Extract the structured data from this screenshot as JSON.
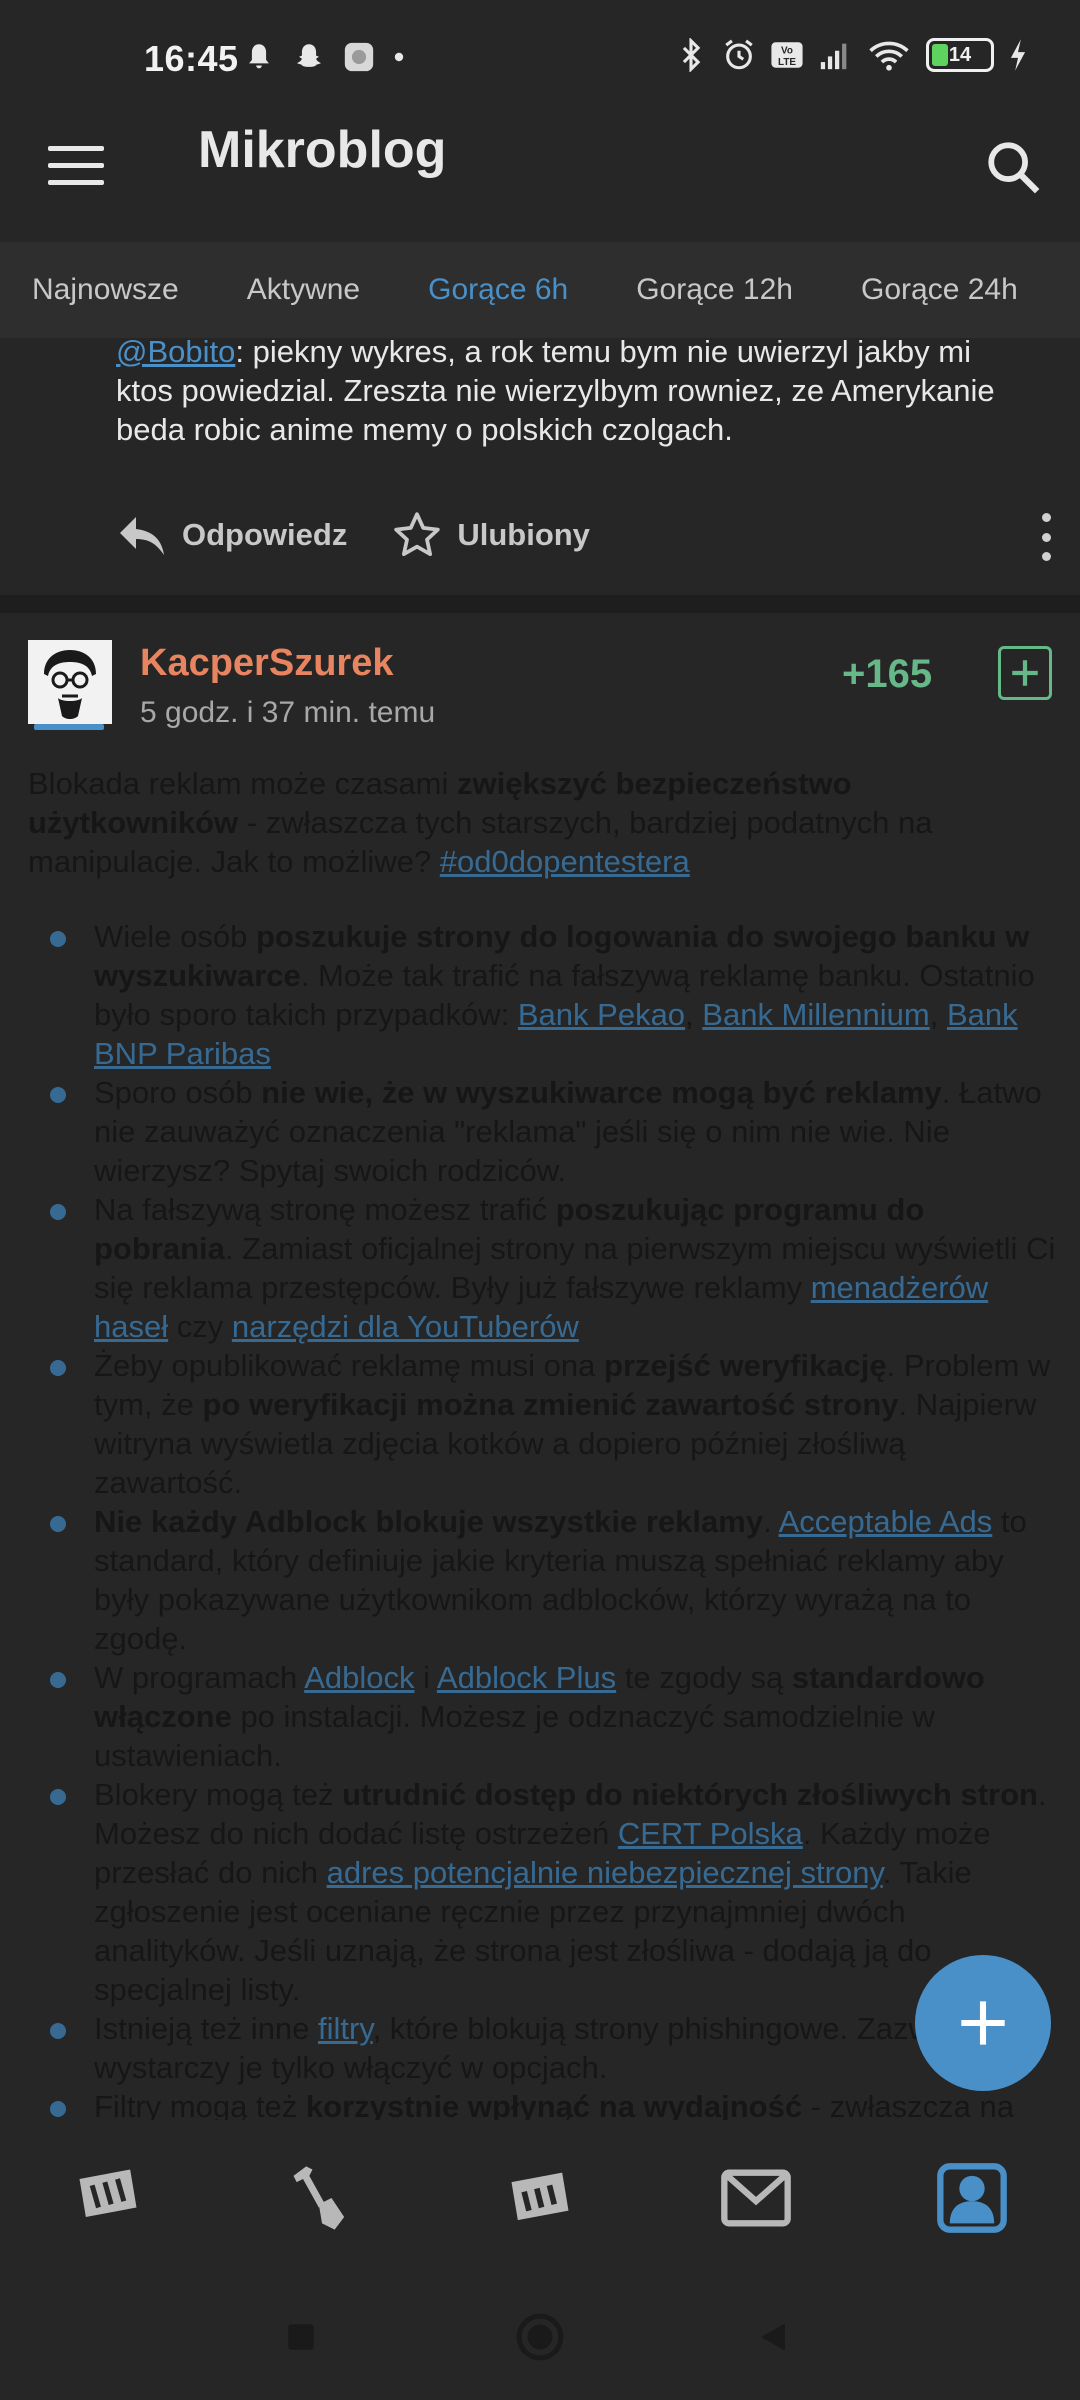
{
  "status_bar": {
    "time": "16:45",
    "battery": "14",
    "icons_left": [
      "bell-icon",
      "snapchat-icon",
      "app-icon",
      "dot-icon"
    ],
    "icons_right": [
      "bluetooth-icon",
      "alarm-icon",
      "volte-icon",
      "signal-icon",
      "wifi-icon",
      "battery-icon",
      "charging-icon"
    ]
  },
  "app_bar": {
    "title": "Mikroblog"
  },
  "tabs": [
    {
      "label": "Najnowsze",
      "active": false
    },
    {
      "label": "Aktywne",
      "active": false
    },
    {
      "label": "Gorące 6h",
      "active": true
    },
    {
      "label": "Gorące 12h",
      "active": false
    },
    {
      "label": "Gorące 24h",
      "active": false
    }
  ],
  "previous_comment": {
    "mention": "@Bobito",
    "text": ": piekny wykres, a rok temu bym nie uwierzyl jakby mi ktos powiedzial. Zreszta nie wierzylbym rowniez, ze Amerykanie beda robic anime memy o polskich czolgach.",
    "reply_label": "Odpowiedz",
    "favorite_label": "Ulubiony"
  },
  "post": {
    "author": "KacperSzurek",
    "time": "5 godz. i 37 min. temu",
    "votes": "+165",
    "intro": {
      "p1": "Blokada reklam może czasami ",
      "b1": "zwiększyć bezpieczeństwo użytkowników",
      "p2": " - zwłaszcza tych starszych, bardziej podatnych na manipulacje. Jak to możliwe? ",
      "tag": "#od0dopentestera"
    },
    "bullets": {
      "b1": {
        "t1": "Wiele osób ",
        "s1": "poszukuje strony do logowania do swojego banku w wyszukiwarce",
        "t2": ". Może tak trafić na fałszywą reklamę banku. Ostatnio było sporo takich przypadków: ",
        "l1": "Bank Pekao",
        "t3": ", ",
        "l2": "Bank Millennium",
        "t4": ", ",
        "l3": "Bank BNP Paribas"
      },
      "b2": {
        "t1": "Sporo osób ",
        "s1": "nie wie, że w wyszukiwarce mogą być reklamy",
        "t2": ". Łatwo nie zauważyć oznaczenia \"reklama\" jeśli się o nim nie wie. Nie wierzysz? Spytaj swoich rodziców."
      },
      "b3": {
        "t1": "Na fałszywą stronę możesz trafić ",
        "s1": "poszukując programu do pobrania",
        "t2": ". Zamiast oficjalnej strony na pierwszym miejscu wyświetli Ci się reklama przestępców. Były już fałszywe reklamy ",
        "l1": "menadżerów haseł",
        "t3": " czy ",
        "l2": "narzędzi dla YouTuberów"
      },
      "b4": {
        "t1": "Żeby opublikować reklamę musi ona ",
        "s1": "przejść weryfikację",
        "t2": ". Problem w tym, że ",
        "s2": "po weryfikacji można zmienić zawartość strony",
        "t3": ". Najpierw witryna wyświetla zdjęcia kotków a dopiero później złośliwą zawartość."
      },
      "b5": {
        "s1": "Nie każdy Adblock blokuje wszystkie reklamy",
        "t1": ". ",
        "l1": "Acceptable Ads",
        "t2": " to standard, który definiuje jakie kryteria muszą spełniać reklamy aby były pokazywane użytkownikom adblocków, którzy wyrażą na to zgodę."
      },
      "b6": {
        "t1": "W programach ",
        "l1": "Adblock",
        "t2": " i ",
        "l2": "Adblock Plus",
        "t3": " te zgody są ",
        "s1": "standardowo włączone",
        "t4": " po instalacji. Możesz je odznaczyć samodzielnie w ustawieniach."
      },
      "b7": {
        "t1": "Blokery mogą też ",
        "s1": "utrudnić dostęp do niektórych złośliwych stron",
        "t2": ". Możesz do nich dodać listę ostrzeżeń ",
        "l1": "CERT Polska",
        "t3": ". Każdy może przesłać do nich ",
        "l2": "adres potencjalnie niebezpiecznej strony",
        "t4": ". Takie zgłoszenie jest oceniane ręcznie przez przynajmniej dwóch analityków. Jeśli uznają, że strona jest złośliwa - dodają ją do specjalnej listy."
      },
      "b8": {
        "t1": "Istnieją też inne ",
        "l1": "filtry",
        "t2": ", które blokują strony phishingowe. Zazwyczaj wystarczy je tylko włączyć w opcjach."
      },
      "b9": {
        "t1": "Filtry mogą też ",
        "s1": "korzystnie wpłynąć na wydajność",
        "t2": " - zwłaszcza na"
      }
    }
  },
  "bottom_nav": [
    "wykop-home-icon",
    "dig-shovel-icon",
    "mikroblog-icon",
    "messages-icon",
    "profile-icon"
  ],
  "colors": {
    "accent": "#4a90c8",
    "author": "#e8845f",
    "votes": "#67b888",
    "background": "#262626"
  }
}
